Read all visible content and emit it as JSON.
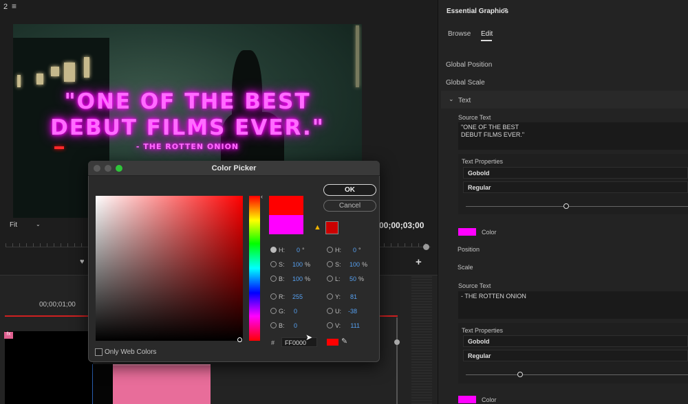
{
  "monitor": {
    "number": "2",
    "overlay_quote": "\"ONE OF THE BEST\nDEBUT FILMS EVER.\"",
    "overlay_line1": "\"ONE OF THE BEST",
    "overlay_line2": "DEBUT FILMS EVER.\"",
    "overlay_credit": "- THE ROTTEN ONION",
    "fit_value": "Fit",
    "timecode": "00;00;03;00"
  },
  "timeline": {
    "timecode": "00;00;01;00",
    "track_label": "fx"
  },
  "essential_graphics": {
    "title": "Essential Graphics",
    "tabs": [
      "Browse",
      "Edit"
    ],
    "global_position": "Global Position",
    "global_scale": "Global Scale",
    "layer_name": "Text",
    "text1": {
      "source_label": "Source Text",
      "source_line1": "\"ONE OF THE BEST",
      "source_line2": "DEBUT FILMS EVER.\"",
      "props_label": "Text Properties",
      "font": "Gobold",
      "style": "Regular",
      "color_label": "Color",
      "position_label": "Position",
      "scale_label": "Scale"
    },
    "text2": {
      "source_label": "Source Text",
      "source_line1": "- THE ROTTEN ONION",
      "props_label": "Text Properties",
      "font": "Gobold",
      "style": "Regular",
      "color_label": "Color"
    }
  },
  "color_picker": {
    "title": "Color Picker",
    "ok_label": "OK",
    "cancel_label": "Cancel",
    "hex_label": "#",
    "hex_value": "FF0000",
    "only_web_colors": "Only Web Colors",
    "left_fields": [
      {
        "label": "H:",
        "value": "0",
        "unit": "°"
      },
      {
        "label": "S:",
        "value": "100",
        "unit": "%"
      },
      {
        "label": "B:",
        "value": "100",
        "unit": "%"
      },
      {
        "label": "R:",
        "value": "255",
        "unit": ""
      },
      {
        "label": "G:",
        "value": "0",
        "unit": ""
      },
      {
        "label": "B:",
        "value": "0",
        "unit": ""
      }
    ],
    "right_fields": [
      {
        "label": "H:",
        "value": "0",
        "unit": "°"
      },
      {
        "label": "S:",
        "value": "100",
        "unit": "%"
      },
      {
        "label": "L:",
        "value": "50",
        "unit": "%"
      },
      {
        "label": "Y:",
        "value": "81",
        "unit": ""
      },
      {
        "label": "U:",
        "value": "-38",
        "unit": ""
      },
      {
        "label": "V:",
        "value": "111",
        "unit": ""
      }
    ],
    "new_color": "#ff0000",
    "old_color": "#ff00ff"
  },
  "colors": {
    "accent_magenta": "#ff00ff",
    "picker_red": "#ff0000",
    "playhead_red": "#d02020",
    "value_blue": "#56a0f0"
  }
}
